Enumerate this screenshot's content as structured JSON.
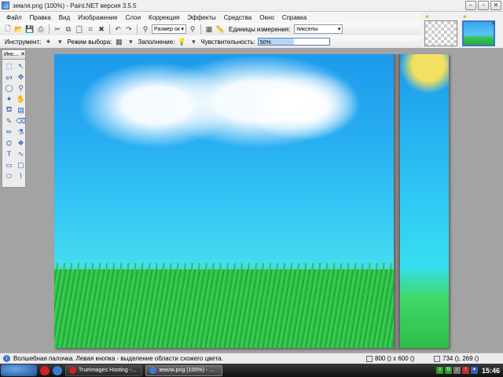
{
  "window": {
    "title": "земля.png (100%) - Paint.NET версия 3.5.5",
    "minimize": "–",
    "maximize": "▫",
    "close": "✕"
  },
  "menu": [
    "Файл",
    "Правка",
    "Вид",
    "Изображение",
    "Слои",
    "Коррекция",
    "Эффекты",
    "Средства",
    "Окно",
    "Справка"
  ],
  "toolbar": {
    "zoom_value": "Размер ок",
    "units_label": "Единицы измерения:",
    "units_value": "пикселы"
  },
  "tool_options": {
    "tool_label": "Инструмент:",
    "selection_mode_label": "Режим выбора:",
    "fill_label": "Заполнение:",
    "tolerance_label": "Чувствительность:",
    "tolerance_value": "50%",
    "tolerance_fraction": 0.5
  },
  "tools_panel": {
    "header": "Инс...",
    "close": "✕",
    "icons": [
      "rectangle-select-icon",
      "move-selection-icon",
      "lasso-select-icon",
      "move-selected-icon",
      "ellipse-select-icon",
      "zoom-icon",
      "magic-wand-icon",
      "pan-icon",
      "paint-bucket-icon",
      "gradient-icon",
      "paintbrush-icon",
      "eraser-icon",
      "pencil-icon",
      "color-picker-icon",
      "clone-stamp-icon",
      "recolor-icon",
      "text-icon",
      "line-curve-icon",
      "rectangle-icon",
      "rounded-rectangle-icon",
      "ellipse-icon",
      "freeform-shape-icon"
    ],
    "glyphs": [
      "⬚",
      "↖",
      "ᔕ",
      "✥",
      "◯",
      "⚲",
      "✦",
      "✋",
      "⛾",
      "▤",
      "✎",
      "⌫",
      "✏",
      "⚗",
      "⛭",
      "❖",
      "T",
      "∿",
      "▭",
      "▢",
      "⬭",
      "⌇"
    ]
  },
  "status": {
    "message": "Волшебная палочка. Левая кнопка - выделение области схожего цвета.",
    "image_size": "800 () x 600 ()",
    "cursor_position": "734 (), 269 ()"
  },
  "taskbar": {
    "tasks": [
      "TrueImages Hosting -...",
      "земля.png (100%) - ..."
    ],
    "clock": "15:46"
  },
  "colors": {
    "accent": "#3a78c8",
    "sky_top": "#1c9aec",
    "grass": "#2ec046",
    "sun": "#f2e060"
  }
}
